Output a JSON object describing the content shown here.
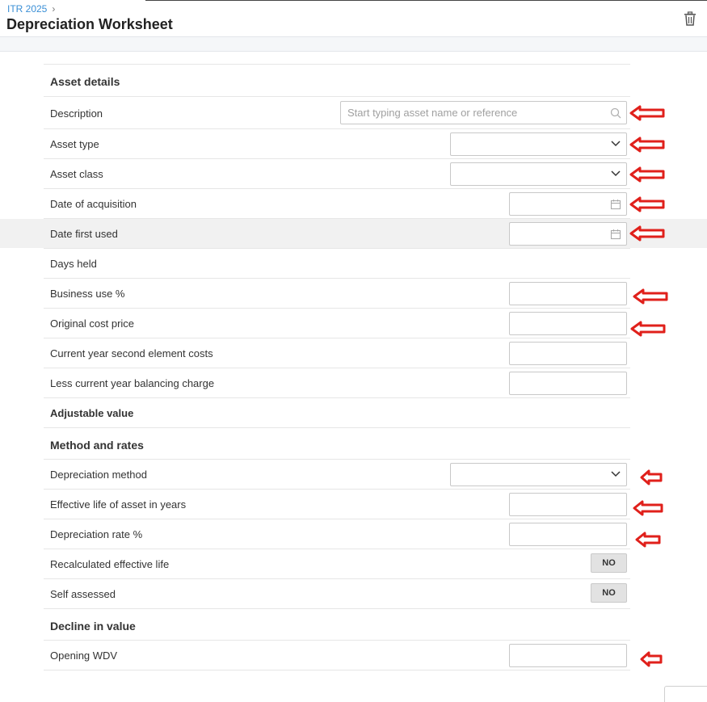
{
  "header": {
    "breadcrumb": "ITR 2025",
    "breadcrumb_sep": "›",
    "title": "Depreciation Worksheet",
    "delete_icon": "trash-icon"
  },
  "sections": {
    "asset_details": {
      "title": "Asset details",
      "description_label": "Description",
      "description_placeholder": "Start typing asset name or reference",
      "description_value": "",
      "asset_type_label": "Asset type",
      "asset_type_value": "",
      "asset_class_label": "Asset class",
      "asset_class_value": "",
      "date_acquisition_label": "Date of acquisition",
      "date_acquisition_value": "",
      "date_first_used_label": "Date first used",
      "date_first_used_value": "",
      "days_held_label": "Days held",
      "business_use_label": "Business use %",
      "business_use_value": "",
      "original_cost_label": "Original cost price",
      "original_cost_value": "",
      "second_element_label": "Current year second element costs",
      "second_element_value": "",
      "balancing_charge_label": "Less current year balancing charge",
      "balancing_charge_value": "",
      "adjustable_value_label": "Adjustable value"
    },
    "method_rates": {
      "title": "Method and rates",
      "depreciation_method_label": "Depreciation method",
      "depreciation_method_value": "",
      "effective_life_label": "Effective life of asset in years",
      "effective_life_value": "",
      "depreciation_rate_label": "Depreciation rate %",
      "depreciation_rate_value": "",
      "recalculated_label": "Recalculated effective life",
      "recalculated_toggle": "NO",
      "self_assessed_label": "Self assessed",
      "self_assessed_toggle": "NO"
    },
    "decline_in_value": {
      "title": "Decline in value",
      "opening_wdv_label": "Opening WDV",
      "opening_wdv_value": ""
    }
  },
  "annotation": {
    "arrow_color": "#e0201b",
    "arrow_icon": "left-arrow-annotation"
  },
  "colors": {
    "link": "#3a8fd6",
    "highlight_row": "#f1f1f1",
    "toggle_bg": "#e2e2e2"
  }
}
